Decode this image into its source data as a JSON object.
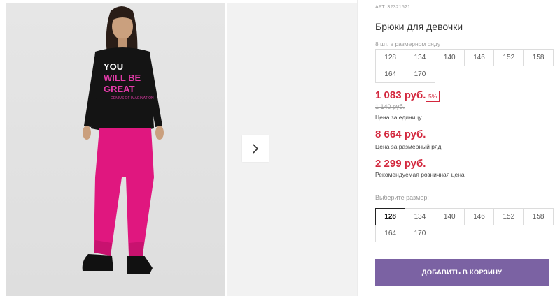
{
  "product": {
    "article": "АРТ. 32321521",
    "title": "Брюки для девочки",
    "pack_note": "8 шт. в размерном ряду",
    "pack_sizes": [
      "128",
      "134",
      "140",
      "146",
      "152",
      "158",
      "164",
      "170"
    ]
  },
  "gallery": {
    "shirt_print": [
      "YOU",
      "WILL BE",
      "GREAT",
      "GENIUS OF IMAGINATION"
    ]
  },
  "prices": {
    "unit_price": "1 083 руб.",
    "discount": "5%",
    "old_price": "1 140 руб.",
    "unit_label": "Цена за единицу",
    "set_price": "8 664 руб.",
    "set_label": "Цена за размерный ряд",
    "rrp_price": "2 299 руб.",
    "rrp_label": "Рекомендуемая розничная цена"
  },
  "size_selector": {
    "label": "Выберите размер:",
    "options": [
      "128",
      "134",
      "140",
      "146",
      "152",
      "158",
      "164",
      "170"
    ],
    "selected": "128"
  },
  "cart": {
    "add_label": "ДОБАВИТЬ В КОРЗИНУ"
  },
  "colors": {
    "price": "#d3273d",
    "button": "#7b62a3",
    "pants": "#e0177f",
    "shirt": "#141414"
  },
  "icons": {
    "next": "chevron-right-icon"
  }
}
